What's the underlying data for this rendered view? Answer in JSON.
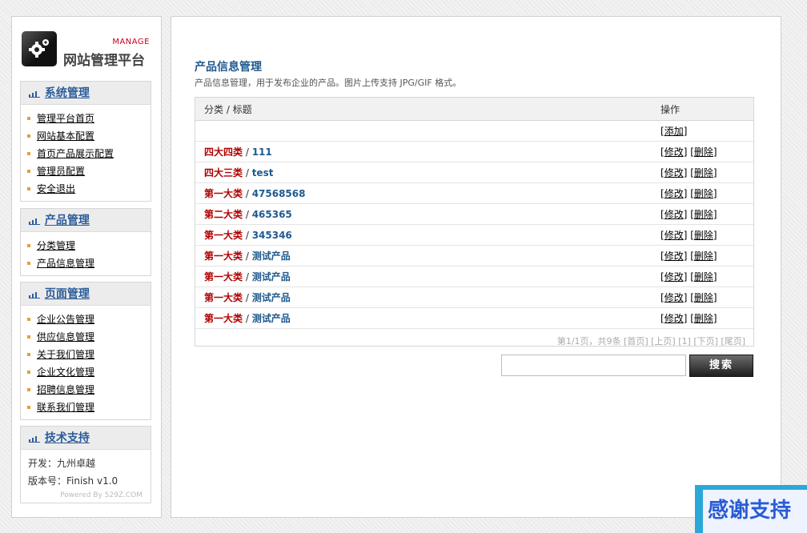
{
  "logo": {
    "manage": "MANAGE",
    "title": "网站管理平台"
  },
  "sidebar": {
    "system": {
      "title": "系统管理",
      "items": [
        "管理平台首页",
        "网站基本配置",
        "首页产品展示配置",
        "管理员配置",
        "安全退出"
      ]
    },
    "product": {
      "title": "产品管理",
      "items": [
        "分类管理",
        "产品信息管理"
      ]
    },
    "page": {
      "title": "页面管理",
      "items": [
        "企业公告管理",
        "供应信息管理",
        "关于我们管理",
        "企业文化管理",
        "招聘信息管理",
        "联系我们管理"
      ]
    },
    "support": {
      "title": "技术支持",
      "developer": "开发：九州卓越",
      "version": "版本号：Finish v1.0",
      "powered": "Powered By 529Z.COM"
    }
  },
  "main": {
    "title": "产品信息管理",
    "description": "产品信息管理，用于发布企业的产品。图片上传支持 JPG/GIF 格式。",
    "table": {
      "col_title": "分类 / 标题",
      "col_action": "操作",
      "add_label": "添加",
      "edit_label": "修改",
      "delete_label": "删除",
      "rows": [
        {
          "category": "四大四类",
          "title": "111"
        },
        {
          "category": "四大三类",
          "title": "test"
        },
        {
          "category": "第一大类",
          "title": "47568568"
        },
        {
          "category": "第二大类",
          "title": "465365"
        },
        {
          "category": "第一大类",
          "title": "345346"
        },
        {
          "category": "第一大类",
          "title": "测试产品"
        },
        {
          "category": "第一大类",
          "title": "测试产品"
        },
        {
          "category": "第一大类",
          "title": "测试产品"
        },
        {
          "category": "第一大类",
          "title": "测试产品"
        }
      ]
    },
    "pager": {
      "summary": "第1/1页，共9条",
      "first": "[首页]",
      "prev": "[上页]",
      "current": "[1]",
      "next": "[下页]",
      "last": "[尾页]"
    },
    "search": {
      "value": "",
      "button": "搜索"
    }
  },
  "banner": {
    "text": "感谢支持"
  },
  "colors": {
    "accent_blue": "#1f5a8f",
    "category_red": "#b00000",
    "banner_blue": "#2ba8d8"
  }
}
